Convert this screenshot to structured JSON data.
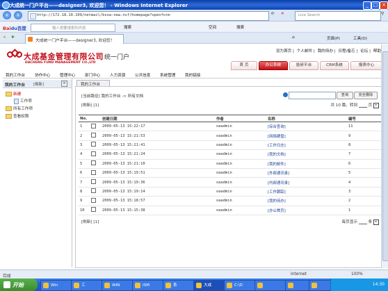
{
  "browser": {
    "title": "大成统一门户平台——designer3, 欢迎您！ - Windows Internet Explorer",
    "url": "http://172.18.10.109/netmail/bsoa-new.nsf/homepage?openform",
    "search_placeholder": "Live Search",
    "tab_label": "大成统一门户平台——designer3, 欢迎您！",
    "baidu": {
      "logo_a": "Bai",
      "logo_b": "du百度",
      "input_placeholder": "输入想要搜索的内容",
      "search_btn": "搜索",
      "space_btn": "空间",
      "search2_btn": "搜索"
    },
    "page_menu": "页面(P)",
    "tools_menu": "工具(O)",
    "status_left": "完成",
    "status_zone": "Internet",
    "zoom": "100%"
  },
  "header": {
    "company_cn": "大成基金管理有限公司",
    "company_en": "DACHENG FUND MANAGEMENT CO.,LTD",
    "portal": "统一门户",
    "top_links": [
      "设为首页",
      "个人邮件",
      "我的待办",
      "日程/备忘",
      "论坛",
      "帮助"
    ],
    "tabs": [
      "首 页",
      "办公系统",
      "投研平台",
      "CRM系统",
      "报表中心"
    ]
  },
  "menu": [
    "我的工作台",
    "协作中心",
    "管理中心",
    "部门中心",
    "人力资源",
    "公共信息",
    "系统管理",
    "我的链接"
  ],
  "left": {
    "title": "我的工作台",
    "refresh": "[刷新]",
    "tree": [
      "新建",
      "工作项",
      "所有工作项",
      "查看权限"
    ]
  },
  "content": {
    "tab": "我的工作台",
    "breadcrumb": "[当前路径] 我的工作台 -> 所有文档",
    "query_btn": "查询",
    "clear_btn": "完全删除",
    "refresh": "[刷新]  [1]",
    "pager_total": "共 10 篇，转到",
    "pager_page": "页",
    "per_page": "每页显示",
    "per_page_unit": "条",
    "columns": [
      "No.",
      "创建日期",
      "作者",
      "名称",
      "编号"
    ],
    "rows": [
      {
        "no": "1",
        "date": "2009-05-13 15:22:17",
        "author": "oaadmin",
        "name": "[综合查询]",
        "code": "11"
      },
      {
        "no": "2",
        "date": "2009-05-13 15:21:53",
        "author": "oaadmin",
        "name": "[网络硬盘]",
        "code": "9"
      },
      {
        "no": "3",
        "date": "2009-05-13 15:21:41",
        "author": "oaadmin",
        "name": "[工作日志]",
        "code": "8"
      },
      {
        "no": "4",
        "date": "2009-05-13 15:21:24",
        "author": "oaadmin",
        "name": "[我的文档]",
        "code": "7"
      },
      {
        "no": "5",
        "date": "2009-05-13 15:21:10",
        "author": "oaadmin",
        "name": "[我的邮件]",
        "code": "6"
      },
      {
        "no": "6",
        "date": "2009-05-13 15:19:51",
        "author": "oaadmin",
        "name": "[外部通讯录]",
        "code": "5"
      },
      {
        "no": "7",
        "date": "2009-05-13 15:19:36",
        "author": "oaadmin",
        "name": "[内部通讯录]",
        "code": "4"
      },
      {
        "no": "8",
        "date": "2009-05-13 15:19:14",
        "author": "oaadmin",
        "name": "[工作跟踪]",
        "code": "3"
      },
      {
        "no": "9",
        "date": "2009-05-13 15:18:57",
        "author": "oaadmin",
        "name": "[我的待办]",
        "code": "2"
      },
      {
        "no": "10",
        "date": "2009-05-13 15:15:38",
        "author": "oaadmin",
        "name": "[办公首页]",
        "code": "1"
      }
    ]
  },
  "taskbar": {
    "start": "开始",
    "items": [
      "Win",
      "工",
      "WIN",
      "ISM",
      "系",
      "大成",
      "C:\\D",
      "",
      "",
      ""
    ],
    "clock": "14:30"
  }
}
